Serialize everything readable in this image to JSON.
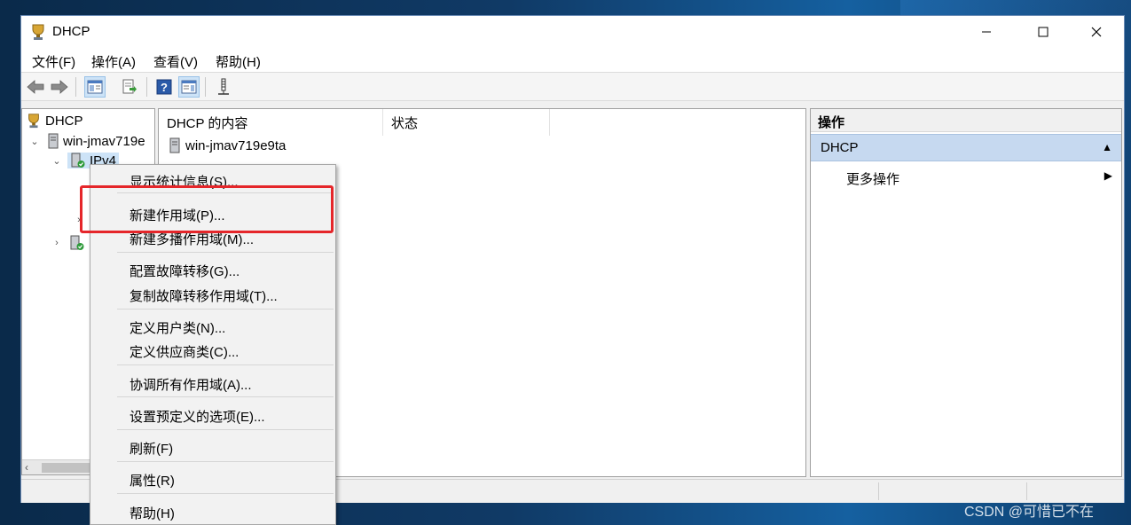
{
  "window": {
    "title": "DHCP",
    "controls": {
      "minimize": "minimize",
      "maximize": "maximize",
      "close": "close"
    }
  },
  "menubar": {
    "items": [
      "文件(F)",
      "操作(A)",
      "查看(V)",
      "帮助(H)"
    ]
  },
  "toolbar": {
    "buttons": [
      "back-arrow-icon",
      "forward-arrow-icon",
      "show-tree-icon",
      "export-list-icon",
      "help-icon",
      "show-action-pane-icon",
      "tool-icon"
    ]
  },
  "tree": {
    "root_label": "DHCP",
    "server_label": "win-jmav719e",
    "ipv4_label": "IPv4"
  },
  "content": {
    "columns": [
      "DHCP 的内容",
      "状态"
    ],
    "rows": [
      {
        "name": "win-jmav719e9ta",
        "status": ""
      }
    ]
  },
  "actions": {
    "header": "操作",
    "section": "DHCP",
    "items": [
      "更多操作"
    ]
  },
  "context_menu": {
    "items": [
      "显示统计信息(S)...",
      "新建作用域(P)...",
      "新建多播作用域(M)...",
      "配置故障转移(G)...",
      "复制故障转移作用域(T)...",
      "定义用户类(N)...",
      "定义供应商类(C)...",
      "协调所有作用域(A)...",
      "设置预定义的选项(E)...",
      "刷新(F)",
      "属性(R)",
      "帮助(H)"
    ],
    "highlighted": "新建作用域(P)..."
  },
  "watermark": "CSDN @可惜已不在",
  "colors": {
    "highlight_box": "#e5262a",
    "section_bg": "#c6d9f0",
    "selection_bg": "#cde3f7"
  }
}
